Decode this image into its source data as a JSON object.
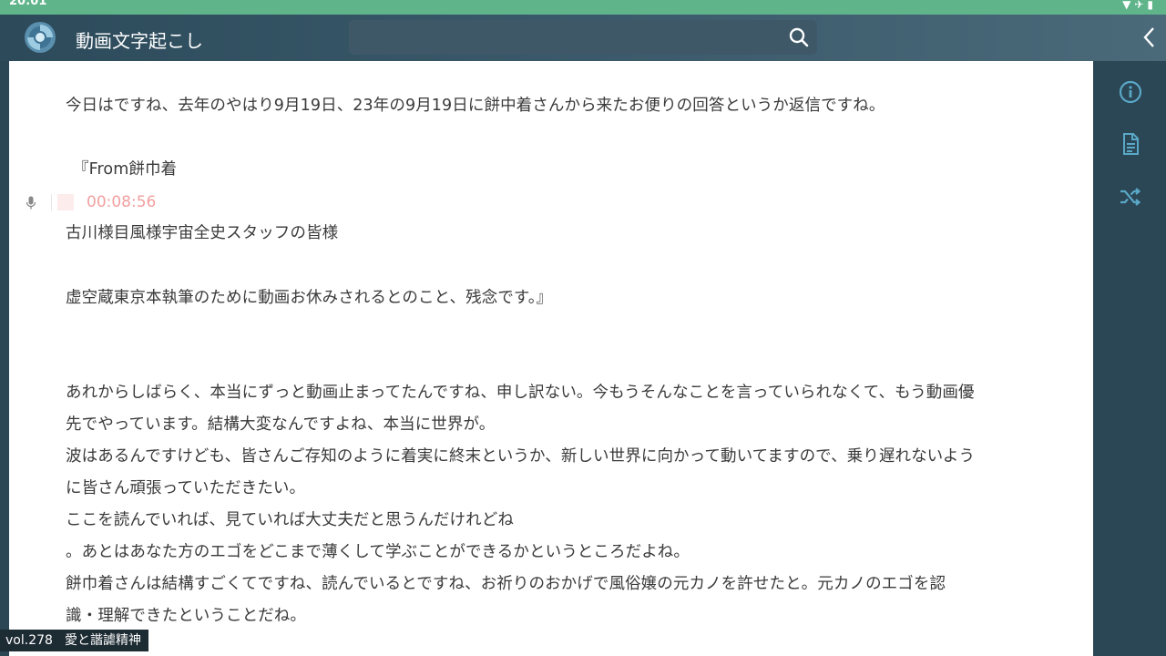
{
  "status": {
    "time": "20:01"
  },
  "app": {
    "title": "動画文字起こし"
  },
  "search": {
    "placeholder": ""
  },
  "timestamp": "00:08:56",
  "transcript": [
    "今日はですね、去年のやはり9月19日、23年の9月19日に餅中着さんから来たお便りの回答というか返信ですね。",
    "『From餅巾着",
    "古川様目風様宇宙全史スタッフの皆様",
    "虚空蔵東京本執筆のために動画お休みされるとのこと、残念です。』",
    "あれからしばらく、本当にずっと動画止まってたんですね、申し訳ない。今もうそんなことを言っていられなくて、もう動画優",
    "先でやっています。結構大変なんですよね、本当に世界が。",
    "波はあるんですけども、皆さんご存知のように着実に終末というか、新しい世界に向かって動いてますので、乗り遅れないよう",
    "に皆さん頑張っていただきたい。",
    "ここを読んでいれば、見ていれば大丈夫だと思うんだけれどね",
    "。あとはあなた方のエゴをどこまで薄くして学ぶことができるかというところだよね。",
    "餅巾着さんは結構すごくてですね、読んでいるとですね、お祈りのおかげで風俗嬢の元カノを許せたと。元カノのエゴを認",
    "識・理解できたということだね。"
  ],
  "footer": {
    "volume": "vol.278",
    "episode_title": "愛と諧謔精神"
  },
  "sidebar": {
    "icons": [
      "info-icon",
      "document-icon",
      "shuffle-icon"
    ]
  },
  "colors": {
    "statusbar": "#5fb48a",
    "appbar": "#2c4a5a",
    "accent": "#5aa8c8",
    "timestamp": "#f2a0a0"
  }
}
